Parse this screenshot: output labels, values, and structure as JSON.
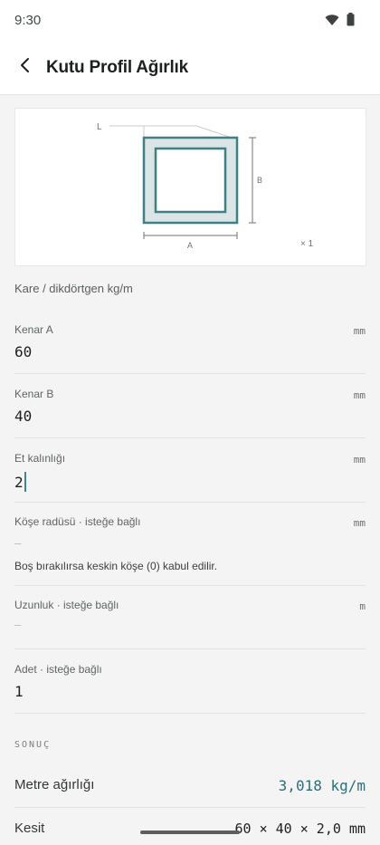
{
  "status": {
    "time": "9:30",
    "icons": [
      "wifi-icon",
      "battery-icon"
    ]
  },
  "header": {
    "title": "Kutu Profil Ağırlık",
    "back_icon": "chevron-left-icon"
  },
  "diagram": {
    "label_l": "L",
    "label_a": "A",
    "label_b": "B",
    "quantity": "× 1",
    "colors": {
      "stroke": "#3f7f86",
      "fill": "#dbe5e5",
      "dim": "#6d7372"
    }
  },
  "subtitle": "Kare / dikdörtgen kg/m",
  "fields": {
    "side_a": {
      "label": "Kenar A",
      "unit": "mm",
      "value": "60"
    },
    "side_b": {
      "label": "Kenar B",
      "unit": "mm",
      "value": "40"
    },
    "thickness": {
      "label": "Et kalınlığı",
      "unit": "mm",
      "value": "2"
    },
    "corner_radius": {
      "label": "Köşe radüsü · isteğe bağlı",
      "unit": "mm",
      "value": "—",
      "hint": "Boş bırakılırsa keskin köşe (0) kabul edilir."
    },
    "length": {
      "label": "Uzunluk · isteğe bağlı",
      "unit": "m",
      "value": "—"
    },
    "quantity": {
      "label": "Adet · isteğe bağlı",
      "value": "1"
    }
  },
  "result": {
    "section_title": "SONUÇ",
    "weight_label": "Metre ağırlığı",
    "weight_value": "3,018 kg/m",
    "section_label": "Kesit",
    "section_value": "60 × 40 × 2,0 mm"
  },
  "colors": {
    "accent": "#2e6e78",
    "background": "#f3f4f3"
  }
}
